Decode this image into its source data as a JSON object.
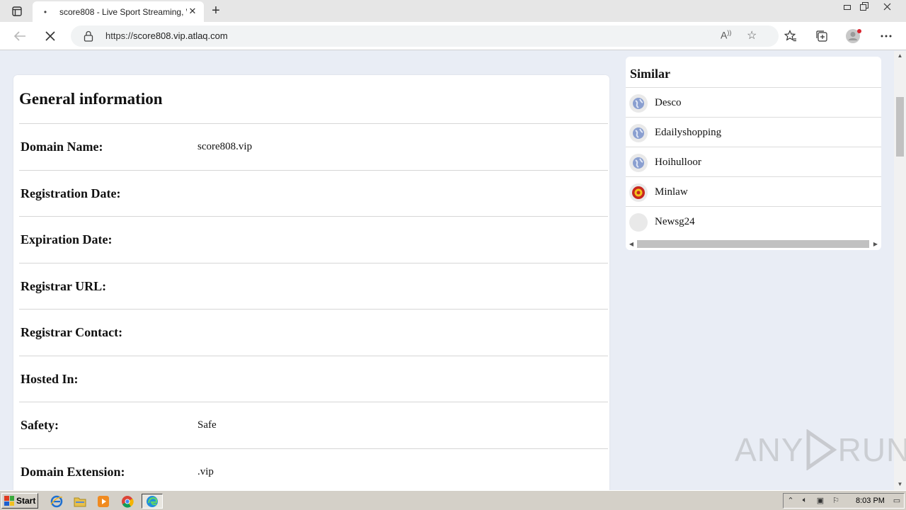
{
  "browser": {
    "tab_title": "score808 - Live Sport Streaming, W",
    "tab_close": "✕",
    "new_tab": "+",
    "url_scheme": "https://",
    "url_host": "score808.vip.atlaq.com"
  },
  "main": {
    "heading": "General information",
    "rows": [
      {
        "label": "Domain Name:",
        "value": "score808.vip"
      },
      {
        "label": "Registration Date:",
        "value": ""
      },
      {
        "label": "Expiration Date:",
        "value": ""
      },
      {
        "label": "Registrar URL:",
        "value": ""
      },
      {
        "label": "Registrar Contact:",
        "value": ""
      },
      {
        "label": "Hosted In:",
        "value": ""
      },
      {
        "label": "Safety:",
        "value": "Safe"
      },
      {
        "label": "Domain Extension:",
        "value": ".vip"
      }
    ]
  },
  "similar": {
    "heading": "Similar",
    "items": [
      {
        "name": "Desco",
        "icon": "globe-icon"
      },
      {
        "name": "Edailyshopping",
        "icon": "globe-icon"
      },
      {
        "name": "Hoihulloor",
        "icon": "globe-icon"
      },
      {
        "name": "Minlaw",
        "icon": "crest-icon"
      },
      {
        "name": "Newsg24",
        "icon": "blank-icon"
      }
    ]
  },
  "watermark": {
    "left": "ANY",
    "right": "RUN"
  },
  "taskbar": {
    "start_label": "Start",
    "clock": "8:03 PM"
  }
}
